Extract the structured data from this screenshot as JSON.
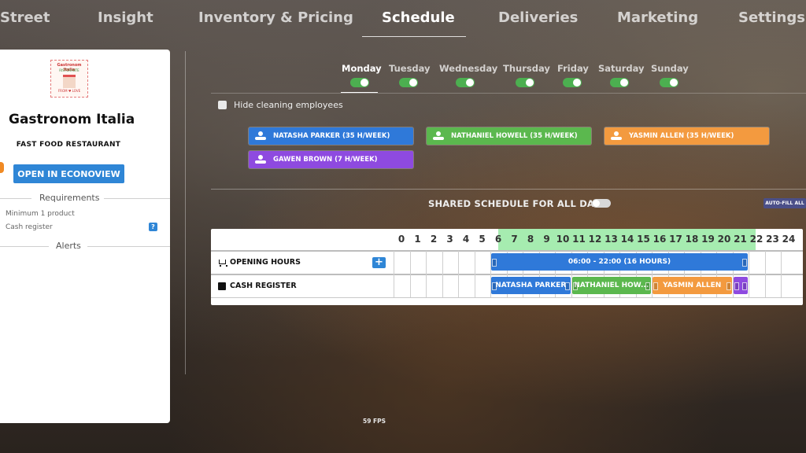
{
  "nav": {
    "tabs": [
      "Street",
      "Insight",
      "Inventory & Pricing",
      "Schedule",
      "Deliveries",
      "Marketing",
      "Settings"
    ],
    "active": "Schedule"
  },
  "business": {
    "logo_line1": "Gastronom Italia",
    "logo_line2": "RISTORANTE",
    "logo_line3": "FROM ♥ LOVE",
    "name": "Gastronom Italia",
    "type": "FAST FOOD RESTAURANT",
    "open_button": "OPEN IN ECONOVIEW",
    "requirements_title": "Requirements",
    "requirements": [
      "Minimum 1 product",
      "Cash register"
    ],
    "help_glyph": "?",
    "alerts_title": "Alerts"
  },
  "days": [
    {
      "label": "Monday",
      "enabled": true
    },
    {
      "label": "Tuesday",
      "enabled": true
    },
    {
      "label": "Wednesday",
      "enabled": true
    },
    {
      "label": "Thursday",
      "enabled": true
    },
    {
      "label": "Friday",
      "enabled": true
    },
    {
      "label": "Saturday",
      "enabled": true
    },
    {
      "label": "Sunday",
      "enabled": true
    }
  ],
  "active_day": "Monday",
  "hide_cleaning_label": "Hide cleaning employees",
  "employees": [
    {
      "label": "NATASHA PARKER (35 H/WEEK)",
      "color": "#2f79d9"
    },
    {
      "label": "NATHANIEL HOWELL (35 H/WEEK)",
      "color": "#5bb84e"
    },
    {
      "label": "YASMIN ALLEN (35 H/WEEK)",
      "color": "#f39a3f"
    },
    {
      "label": "GAWEN BROWN (7 H/WEEK)",
      "color": "#8e4ae0"
    }
  ],
  "shared_schedule_label": "SHARED SCHEDULE FOR ALL DAYS",
  "shared_schedule_enabled": false,
  "autofill_label": "AUTO-FILL ALL",
  "schedule": {
    "hours": [
      "0",
      "1",
      "2",
      "3",
      "4",
      "5",
      "6",
      "7",
      "8",
      "9",
      "10",
      "11",
      "12",
      "13",
      "14",
      "15",
      "16",
      "17",
      "18",
      "19",
      "20",
      "21",
      "22",
      "23",
      "24"
    ],
    "rows": [
      {
        "label": "OPENING HOURS",
        "icon": "cart-icon"
      },
      {
        "label": "CASH REGISTER",
        "icon": "cash-register-icon"
      }
    ],
    "add_glyph": "+",
    "opening_bar": {
      "label": "06:00 - 22:00 (16 HOURS)",
      "start": 6,
      "end": 22
    },
    "shifts": [
      {
        "label": "NATASHA PARKER",
        "start": 6,
        "end": 11,
        "color": "blue"
      },
      {
        "label": "NATHANIEL HOW...",
        "start": 11,
        "end": 16,
        "color": "green"
      },
      {
        "label": "YASMIN ALLEN",
        "start": 16,
        "end": 21,
        "color": "orange"
      },
      {
        "label": "",
        "start": 21,
        "end": 22,
        "color": "purple"
      }
    ]
  },
  "fps": "59 FPS"
}
